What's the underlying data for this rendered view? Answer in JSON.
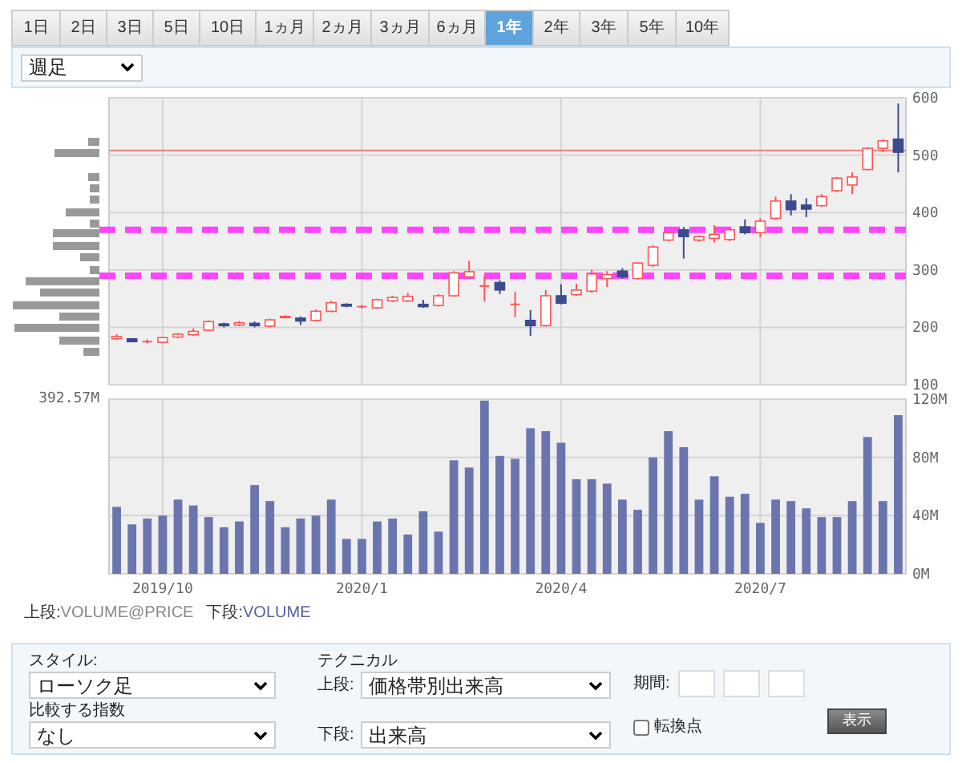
{
  "period_tabs": [
    {
      "label": "1日",
      "selected": false
    },
    {
      "label": "2日",
      "selected": false
    },
    {
      "label": "3日",
      "selected": false
    },
    {
      "label": "5日",
      "selected": false
    },
    {
      "label": "10日",
      "selected": false
    },
    {
      "label": "1ヵ月",
      "selected": false
    },
    {
      "label": "2ヵ月",
      "selected": false
    },
    {
      "label": "3ヵ月",
      "selected": false
    },
    {
      "label": "6ヵ月",
      "selected": false
    },
    {
      "label": "1年",
      "selected": true
    },
    {
      "label": "2年",
      "selected": false
    },
    {
      "label": "3年",
      "selected": false
    },
    {
      "label": "5年",
      "selected": false
    },
    {
      "label": "10年",
      "selected": false
    }
  ],
  "interval_select": {
    "value": "週足"
  },
  "price_chart": {
    "chart_data": {
      "type": "candlestick",
      "grid": true,
      "ylim": [
        100,
        600
      ],
      "yticks": [
        100,
        200,
        300,
        400,
        500,
        600
      ],
      "categories": [
        null,
        null,
        null,
        null,
        null,
        null,
        null,
        null,
        null,
        null,
        null,
        null,
        null,
        null,
        null,
        null,
        null,
        null,
        null,
        null,
        null,
        null,
        null,
        null,
        null,
        null,
        null,
        null,
        null,
        null,
        null,
        null,
        null,
        null,
        null,
        null,
        null,
        null,
        null,
        null,
        null,
        null,
        null,
        null,
        null,
        null,
        null,
        null,
        null,
        null,
        null,
        null
      ],
      "ohlc": [
        [
          180,
          188,
          178,
          184
        ],
        [
          180,
          181,
          174,
          175
        ],
        [
          175,
          179,
          172,
          175
        ],
        [
          174,
          183,
          173,
          182
        ],
        [
          183,
          190,
          181,
          188
        ],
        [
          187,
          198,
          185,
          193
        ],
        [
          195,
          212,
          194,
          210
        ],
        [
          206,
          208,
          200,
          203
        ],
        [
          204,
          211,
          202,
          208
        ],
        [
          207,
          210,
          200,
          203
        ],
        [
          202,
          215,
          200,
          213
        ],
        [
          217,
          221,
          215,
          219
        ],
        [
          216,
          219,
          204,
          211
        ],
        [
          212,
          231,
          210,
          228
        ],
        [
          228,
          246,
          226,
          243
        ],
        [
          240,
          242,
          235,
          237
        ],
        [
          236,
          239,
          233,
          236
        ],
        [
          234,
          250,
          232,
          248
        ],
        [
          246,
          255,
          244,
          252
        ],
        [
          246,
          260,
          244,
          254
        ],
        [
          240,
          248,
          234,
          236
        ],
        [
          238,
          258,
          236,
          255
        ],
        [
          255,
          298,
          253,
          295
        ],
        [
          288,
          316,
          286,
          297
        ],
        [
          272,
          290,
          245,
          272
        ],
        [
          278,
          282,
          258,
          265
        ],
        [
          240,
          262,
          218,
          240
        ],
        [
          212,
          230,
          185,
          203
        ],
        [
          203,
          265,
          201,
          255
        ],
        [
          255,
          275,
          240,
          242
        ],
        [
          257,
          276,
          255,
          265
        ],
        [
          263,
          300,
          260,
          293
        ],
        [
          285,
          298,
          270,
          292
        ],
        [
          298,
          303,
          285,
          288
        ],
        [
          285,
          314,
          283,
          312
        ],
        [
          308,
          343,
          305,
          340
        ],
        [
          352,
          368,
          350,
          365
        ],
        [
          370,
          375,
          320,
          358
        ],
        [
          352,
          360,
          349,
          358
        ],
        [
          355,
          378,
          348,
          362
        ],
        [
          353,
          373,
          350,
          370
        ],
        [
          375,
          388,
          362,
          365
        ],
        [
          365,
          390,
          357,
          385
        ],
        [
          390,
          428,
          388,
          420
        ],
        [
          420,
          432,
          395,
          405
        ],
        [
          413,
          425,
          392,
          406
        ],
        [
          412,
          432,
          410,
          428
        ],
        [
          438,
          462,
          436,
          460
        ],
        [
          448,
          470,
          432,
          462
        ],
        [
          475,
          514,
          473,
          512
        ],
        [
          512,
          528,
          505,
          525
        ],
        [
          528,
          590,
          470,
          505
        ]
      ],
      "ref_lines": [
        {
          "axis": "y",
          "value": 508,
          "color": "#f08080"
        },
        {
          "axis": "y",
          "value": 370,
          "color": "#ff44ff"
        },
        {
          "axis": "y",
          "value": 290,
          "color": "#ff44ff"
        }
      ]
    }
  },
  "volume_chart": {
    "max_label": "392.57M",
    "chart_data": {
      "type": "bar",
      "grid": true,
      "ylim": [
        0,
        120
      ],
      "yticks": [
        {
          "value": 0,
          "label": "0M"
        },
        {
          "value": 40,
          "label": "40M"
        },
        {
          "value": 80,
          "label": "80M"
        },
        {
          "value": 120,
          "label": "120M"
        }
      ],
      "categories": [
        null,
        null,
        null,
        "2019/10",
        null,
        null,
        null,
        null,
        null,
        null,
        null,
        null,
        null,
        null,
        null,
        null,
        "2020/1",
        null,
        null,
        null,
        null,
        null,
        null,
        null,
        null,
        null,
        null,
        null,
        null,
        "2020/4",
        null,
        null,
        null,
        null,
        null,
        null,
        null,
        null,
        null,
        null,
        null,
        null,
        "2020/7",
        null,
        null,
        null,
        null,
        null,
        null,
        null,
        null,
        null
      ],
      "values": [
        46,
        34,
        38,
        40,
        51,
        47,
        39,
        32,
        36,
        61,
        50,
        32,
        38,
        40,
        51,
        24,
        24,
        36,
        38,
        27,
        43,
        29,
        78,
        73,
        119,
        81,
        79,
        100,
        98,
        90,
        65,
        65,
        62,
        51,
        44,
        80,
        98,
        87,
        51,
        67,
        53,
        55,
        35,
        51,
        50,
        45,
        39,
        39,
        50,
        94,
        50,
        109
      ]
    }
  },
  "legend": [
    {
      "label": "上段:",
      "value": "VOLUME@PRICE",
      "color": "#888888"
    },
    {
      "label": "下段:",
      "value": "VOLUME",
      "color": "#5561a0"
    }
  ],
  "settings": {
    "style_label": "スタイル:",
    "style_value": "ローソク足",
    "index_label": "比較する指数",
    "index_value": "なし",
    "technical_label": "テクニカル",
    "upper_label": "上段:",
    "upper_value": "価格帯別出来高",
    "lower_label": "下段:",
    "lower_value": "出来高",
    "period_label": "期間:",
    "turning_point": {
      "label": "転換点",
      "checked": false
    },
    "show_button": "表示"
  }
}
